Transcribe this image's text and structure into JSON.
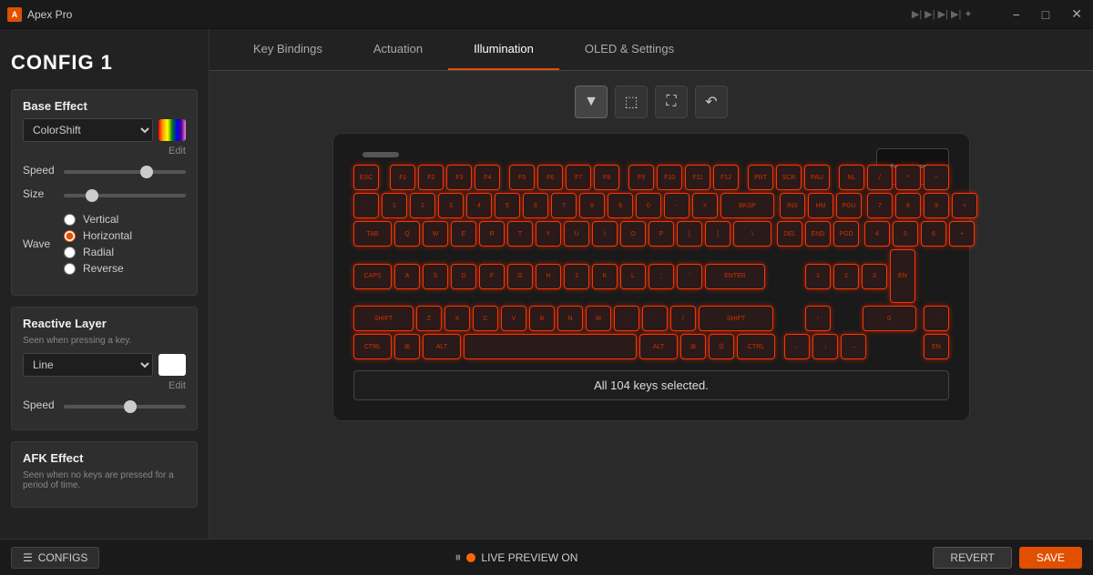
{
  "titlebar": {
    "app_name": "Apex Pro",
    "minimize_label": "−",
    "maximize_label": "□",
    "close_label": "✕"
  },
  "config_title": "CONFIG 1",
  "tabs": [
    {
      "id": "key-bindings",
      "label": "Key Bindings",
      "active": false
    },
    {
      "id": "actuation",
      "label": "Actuation",
      "active": false
    },
    {
      "id": "illumination",
      "label": "Illumination",
      "active": true
    },
    {
      "id": "oled-settings",
      "label": "OLED & Settings",
      "active": false
    }
  ],
  "toolbar": {
    "select_tool": "▼",
    "rect_select": "⬜",
    "full_select": "⛶",
    "undo": "↶"
  },
  "sidebar": {
    "base_effect": {
      "title": "Base Effect",
      "effect_name": "ColorShift",
      "edit_label": "Edit",
      "speed_label": "Speed",
      "size_label": "Size",
      "wave_label": "Wave",
      "wave_options": [
        {
          "id": "vertical",
          "label": "Vertical",
          "selected": false
        },
        {
          "id": "horizontal",
          "label": "Horizontal",
          "selected": true
        },
        {
          "id": "radial",
          "label": "Radial",
          "selected": false
        },
        {
          "id": "reverse",
          "label": "Reverse",
          "selected": false
        }
      ]
    },
    "reactive_layer": {
      "title": "Reactive Layer",
      "subtitle": "Seen when pressing a key.",
      "effect_name": "Line",
      "edit_label": "Edit",
      "speed_label": "Speed"
    },
    "afk_effect": {
      "title": "AFK Effect",
      "subtitle": "Seen when no keys are pressed for a period of time."
    }
  },
  "keyboard": {
    "status_text": "All 104 keys selected.",
    "oled_text": "thegamingsetup"
  },
  "bottom_bar": {
    "configs_label": "CONFIGS",
    "live_preview_label": "LIVE PREVIEW ON",
    "revert_label": "REVERT",
    "save_label": "SAVE"
  }
}
